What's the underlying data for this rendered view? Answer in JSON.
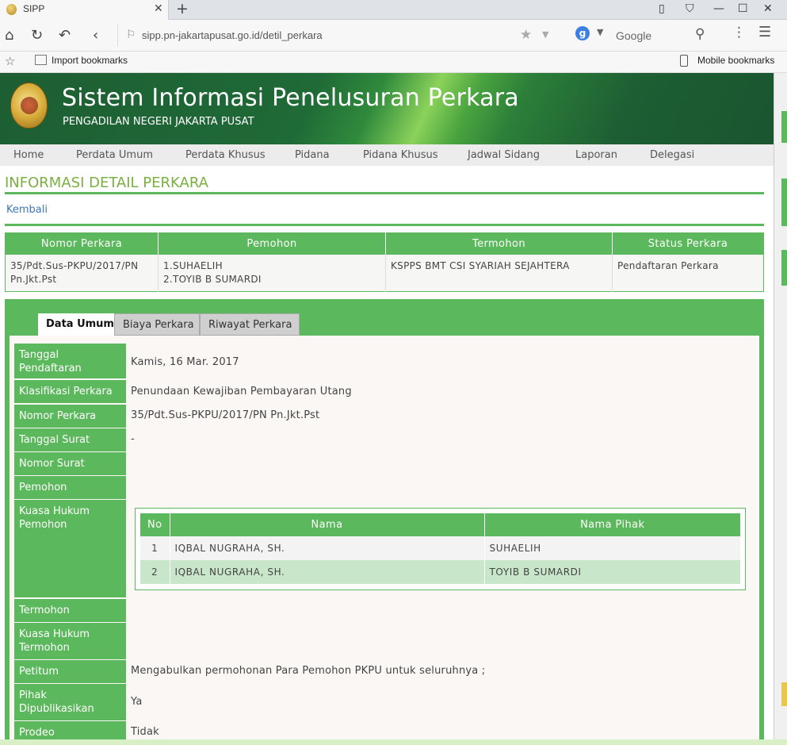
{
  "browser": {
    "tab_title": "SIPP",
    "tab_close": "✕",
    "new_tab": "+",
    "url": "sipp.pn-jakartapusat.go.id/detil_perkara",
    "search_placeholder": "Google",
    "search_engine_letter": "g",
    "bookmark_import": "Import bookmarks",
    "bookmark_mobile": "Mobile bookmarks"
  },
  "site": {
    "title": "Sistem Informasi Penelusuran Perkara",
    "subtitle": "PENGADILAN NEGERI JAKARTA PUSAT"
  },
  "menu": [
    "Home",
    "Perdata Umum",
    "Perdata Khusus",
    "Pidana",
    "Pidana Khusus",
    "Jadwal Sidang",
    "Laporan",
    "Delegasi"
  ],
  "page": {
    "heading": "INFORMASI DETAIL PERKARA",
    "back_link": "Kembali"
  },
  "summary": {
    "headers": [
      "Nomor Perkara",
      "Pemohon",
      "Termohon",
      "Status Perkara"
    ],
    "row": {
      "nomor_line1": "35/Pdt.Sus-PKPU/2017/PN",
      "nomor_line2": "Pn.Jkt.Pst",
      "pemohon_line1": "1.SUHAELIH",
      "pemohon_line2": "2.TOYIB B SUMARDI",
      "termohon": "KSPPS BMT CSI SYARIAH SEJAHTERA",
      "status": "Pendaftaran Perkara"
    }
  },
  "tabs": [
    "Data Umum",
    "Biaya Perkara",
    "Riwayat Perkara"
  ],
  "fields": {
    "tanggal_pendaftaran": {
      "label_line1": "Tanggal",
      "label_line2": "Pendaftaran",
      "value": "Kamis, 16 Mar. 2017"
    },
    "klasifikasi": {
      "label": "Klasifikasi Perkara",
      "value": "Penundaan Kewajiban Pembayaran Utang"
    },
    "nomor_perkara": {
      "label": "Nomor Perkara",
      "value": "35/Pdt.Sus-PKPU/2017/PN Pn.Jkt.Pst"
    },
    "tanggal_surat": {
      "label": "Tanggal Surat",
      "value": "-"
    },
    "nomor_surat": {
      "label": "Nomor Surat",
      "value": ""
    },
    "pemohon": {
      "label": "Pemohon",
      "value": ""
    },
    "kuasa_pemohon": {
      "label_line1": "Kuasa Hukum",
      "label_line2": "Pemohon"
    },
    "termohon": {
      "label": "Termohon",
      "value": ""
    },
    "kuasa_termohon": {
      "label_line1": "Kuasa Hukum",
      "label_line2": "Termohon"
    },
    "petitum": {
      "label": "Petitum",
      "value": "Mengabulkan permohonan Para Pemohon PKPU untuk seluruhnya ;"
    },
    "pihak_dipublikasikan": {
      "label_line1": "Pihak",
      "label_line2": "Dipublikasikan",
      "value": "Ya"
    },
    "prodeo": {
      "label": "Prodeo",
      "value": "Tidak"
    }
  },
  "kuasa_table": {
    "headers": [
      "No",
      "Nama",
      "Nama Pihak"
    ],
    "rows": [
      {
        "no": "1",
        "nama": "IQBAL NUGRAHA, SH.",
        "pihak": "SUHAELIH"
      },
      {
        "no": "2",
        "nama": "IQBAL NUGRAHA, SH.",
        "pihak": "TOYIB B SUMARDI"
      }
    ]
  }
}
